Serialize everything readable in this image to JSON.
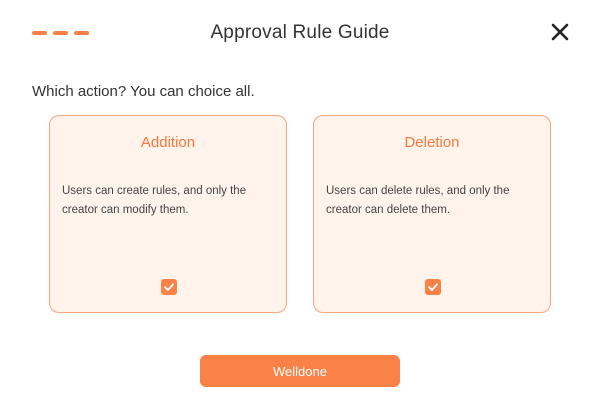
{
  "modal": {
    "title": "Approval Rule Guide",
    "question": "Which action? You can choice all.",
    "accent_color": "#FA8246",
    "step_indicator": {
      "steps": 3
    },
    "close_icon": "close-icon"
  },
  "options": [
    {
      "title": "Addition",
      "description": "Users can create rules, and only the creator can modify them.",
      "checked": true,
      "check_icon": "checkmark-icon"
    },
    {
      "title": "Deletion",
      "description": "Users can delete rules, and only the creator can delete them.",
      "checked": true,
      "check_icon": "checkmark-icon"
    }
  ],
  "footer": {
    "confirm_label": "Welldone"
  }
}
